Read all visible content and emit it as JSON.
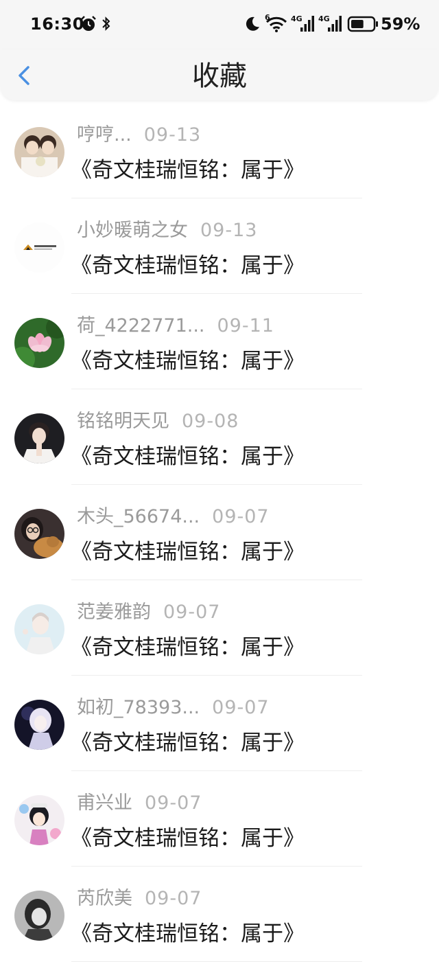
{
  "status_bar": {
    "time": "16:30",
    "network_a": "4G",
    "network_b": "4G",
    "wifi_label": "6",
    "battery_percent": "59%",
    "battery_level": 0.59
  },
  "header": {
    "title": "收藏"
  },
  "items": [
    {
      "user": "哼哼...",
      "date": "09-13",
      "title": "《奇文桂瑞恒铭：属于》"
    },
    {
      "user": "小妙暖萌之女",
      "date": "09-13",
      "title": "《奇文桂瑞恒铭：属于》"
    },
    {
      "user": "荷_4222771...",
      "date": "09-11",
      "title": "《奇文桂瑞恒铭：属于》"
    },
    {
      "user": "铭铭明天见",
      "date": "09-08",
      "title": "《奇文桂瑞恒铭：属于》"
    },
    {
      "user": "木头_56674...",
      "date": "09-07",
      "title": "《奇文桂瑞恒铭：属于》"
    },
    {
      "user": "范姜雅韵",
      "date": "09-07",
      "title": "《奇文桂瑞恒铭：属于》"
    },
    {
      "user": "如初_78393...",
      "date": "09-07",
      "title": "《奇文桂瑞恒铭：属于》"
    },
    {
      "user": "甫兴业",
      "date": "09-07",
      "title": "《奇文桂瑞恒铭：属于》"
    },
    {
      "user": "芮欣美",
      "date": "09-07",
      "title": "《奇文桂瑞恒铭：属于》"
    }
  ],
  "colors": {
    "accent": "#4a90e2",
    "username": "#9a9a9a",
    "date": "#b4b4b4"
  }
}
